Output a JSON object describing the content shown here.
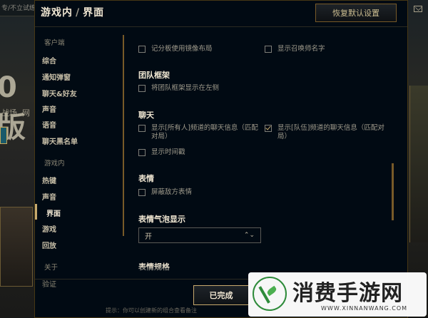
{
  "background": {
    "left_crumb": "专/不立试练",
    "left_big": "0版",
    "left_sub": "战场, 网"
  },
  "dialog": {
    "title_prefix": "游戏内",
    "title_sep": "/",
    "title_current": "界面",
    "reset_label": "恢复默认设置",
    "done_label": "已完成"
  },
  "sidebar": {
    "client_section": "客户端",
    "client_items": [
      "综合",
      "通知弹窗",
      "聊天&好友",
      "声音",
      "语音",
      "聊天黑名单"
    ],
    "ingame_section": "游戏内",
    "ingame_items": [
      "热键",
      "声音",
      "界面",
      "游戏",
      "回放"
    ],
    "about_section": "关于",
    "about_items": [
      "验证"
    ]
  },
  "content": {
    "opt_mirror": "记分板使用镜像布局",
    "opt_summoner": "显示召唤师名字",
    "team_frame_title": "团队框架",
    "opt_team_left": "将团队框架显示在左侧",
    "chat_title": "聊天",
    "opt_all_chat": "显示[所有人]频道的聊天信息（匹配对局）",
    "opt_party_chat": "显示[队伍]频道的聊天信息（匹配对局）",
    "opt_timestamp": "显示时间戳",
    "emote_title": "表情",
    "opt_mute_enemy": "屏蔽敌方表情",
    "bubble_title": "表情气泡显示",
    "bubble_value": "开",
    "emote_size_title": "表情规格"
  },
  "footnote": "提示：你可以创建新的组合查看备注",
  "watermark": {
    "text": "消费手游网",
    "url": "WWW.XINNANWANG.COM"
  },
  "colors": {
    "accent_gold": "#c8aa6e",
    "panel_bg": "#010a13"
  }
}
